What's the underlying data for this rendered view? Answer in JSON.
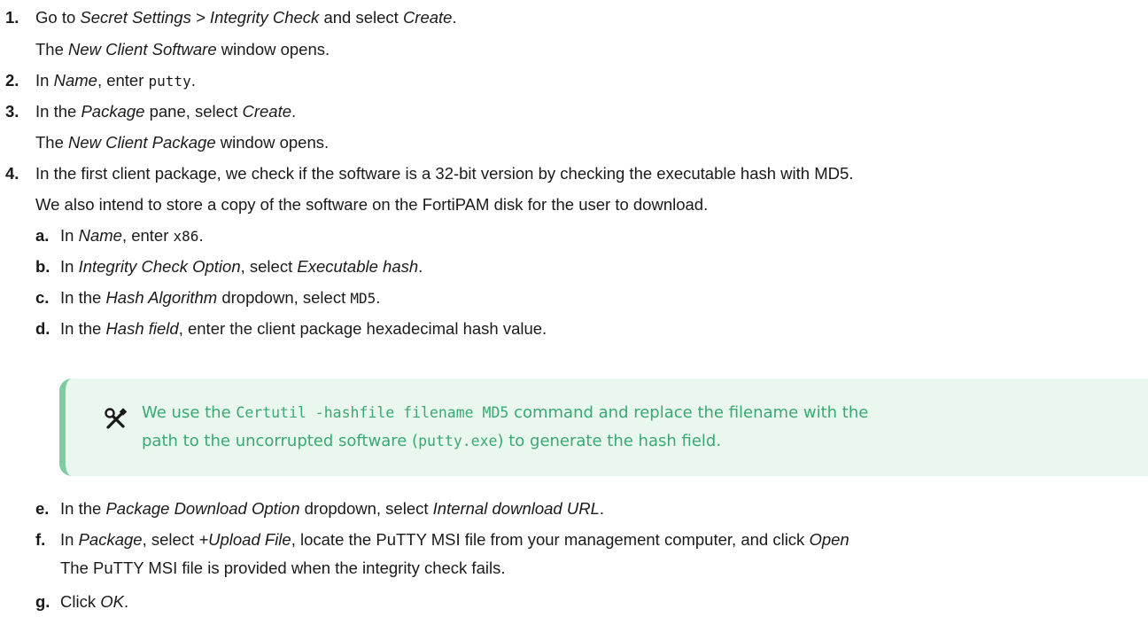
{
  "steps": {
    "s1": {
      "num": "1.",
      "a": "Go to ",
      "b": "Secret Settings > Integrity Check",
      "c": " and select ",
      "d": "Create",
      "e": "."
    },
    "s1r": {
      "a": "The ",
      "b": "New Client Software",
      "c": " window opens."
    },
    "s2": {
      "num": "2.",
      "a": "In ",
      "b": "Name",
      "c": ", enter ",
      "d": "putty",
      "e": "."
    },
    "s3": {
      "num": "3.",
      "a": "In the ",
      "b": "Package",
      "c": " pane, select ",
      "d": "Create",
      "e": "."
    },
    "s3r": {
      "a": "The ",
      "b": "New Client Package",
      "c": " window opens."
    },
    "s4": {
      "num": "4.",
      "a": "In the first client package, we check if the software is a 32-bit version by checking the executable hash with MD5."
    },
    "s4r": {
      "a": "We also intend to store a copy of the software on the FortiPAM disk for the user to download."
    },
    "sa": {
      "num": "a.",
      "a": "In ",
      "b": "Name",
      "c": ", enter ",
      "d": "x86",
      "e": "."
    },
    "sb": {
      "num": "b.",
      "a": "In ",
      "b": "Integrity Check Option",
      "c": ", select ",
      "d": "Executable hash",
      "e": "."
    },
    "sc": {
      "num": "c.",
      "a": "In the ",
      "b": "Hash Algorithm",
      "c": " dropdown, select ",
      "d": "MD5",
      "e": "."
    },
    "sd": {
      "num": "d.",
      "a": "In the ",
      "b": "Hash field",
      "c": ", enter the client package hexadecimal hash value."
    },
    "tip": {
      "l1a": "We use the ",
      "l1b": "Certutil -hashfile filename MD5",
      "l1c": " command and replace the filename with the",
      "l2a": "path to the uncorrupted software (",
      "l2b": "putty.exe",
      "l2c": ") to generate the hash field."
    },
    "se": {
      "num": "e.",
      "a": "In the ",
      "b": "Package Download Option",
      "c": " dropdown, select ",
      "d": "Internal download URL",
      "e": "."
    },
    "sf": {
      "num": "f.",
      "a": "In ",
      "b": "Package",
      "c": ", select ",
      "d": "+Upload File",
      "e": ", locate the PuTTY MSI file from your management computer, and click ",
      "f": "Open"
    },
    "sfr": {
      "a": "The PuTTY MSI file is provided when the integrity check fails."
    },
    "sg": {
      "num": "g.",
      "a": "Click ",
      "b": "OK",
      "c": "."
    }
  },
  "icons": {
    "tip": "wrench-screwdriver-icon"
  },
  "colors": {
    "tip_bg": "#e9f7ef",
    "tip_border": "#7dcda0",
    "tip_text": "#3aa873"
  }
}
